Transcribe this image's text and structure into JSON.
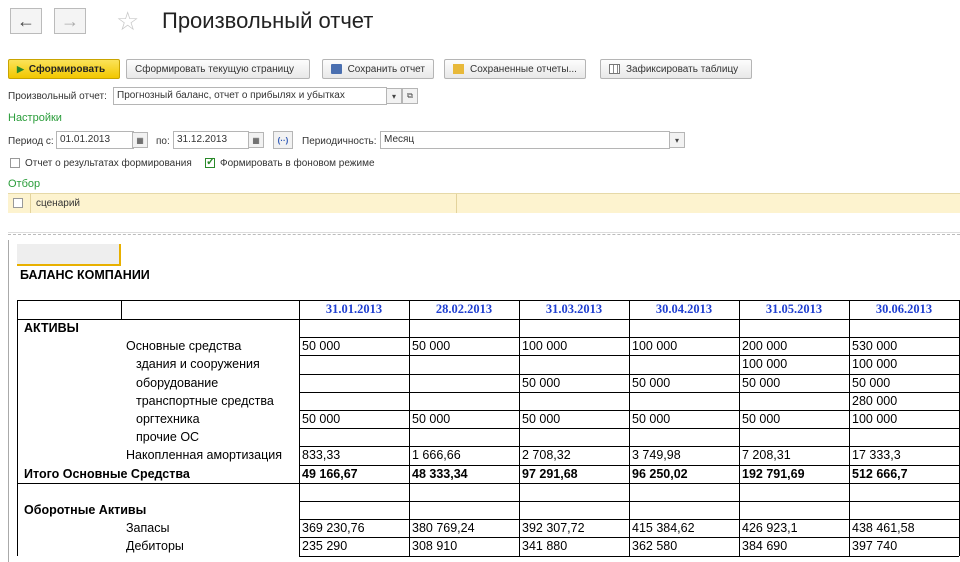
{
  "window": {
    "title": "Произвольный отчет"
  },
  "toolbar": {
    "generate": "Сформировать",
    "generate_page": "Сформировать текущую страницу",
    "save": "Сохранить отчет",
    "saved": "Сохраненные отчеты...",
    "fix_table": "Зафиксировать таблицу"
  },
  "report_select": {
    "label": "Произвольный отчет:",
    "value": "Прогнозный баланс, отчет о прибылях и убытках"
  },
  "settings": {
    "heading": "Настройки",
    "period_from_label": "Период с:",
    "period_from": "01.01.2013",
    "period_to_label": "по:",
    "period_to": "31.12.2013",
    "periodicity_label": "Периодичность:",
    "periodicity": "Месяц",
    "opt_results": "Отчет о результатах формирования",
    "opt_results_checked": false,
    "opt_background": "Формировать в фоновом режиме",
    "opt_background_checked": true
  },
  "filter": {
    "heading": "Отбор",
    "item": "сценарий"
  },
  "report": {
    "title": "БАЛАНС КОМПАНИИ",
    "dates": [
      "31.01.2013",
      "28.02.2013",
      "31.03.2013",
      "30.04.2013",
      "31.05.2013",
      "30.06.2013"
    ],
    "rows": [
      {
        "label": "АКТИВЫ",
        "level": 0,
        "bold": true,
        "values": [
          "",
          "",
          "",
          "",
          "",
          ""
        ]
      },
      {
        "label": "Основные средства",
        "level": 1,
        "bold": false,
        "values": [
          "50 000",
          "50 000",
          "100 000",
          "100 000",
          "200 000",
          "530 000"
        ]
      },
      {
        "label": "здания и сооружения",
        "level": 2,
        "bold": false,
        "values": [
          "",
          "",
          "",
          "",
          "100 000",
          "100 000"
        ]
      },
      {
        "label": "оборудование",
        "level": 2,
        "bold": false,
        "values": [
          "",
          "",
          "50 000",
          "50 000",
          "50 000",
          "50 000"
        ]
      },
      {
        "label": "транспортные средства",
        "level": 2,
        "bold": false,
        "values": [
          "",
          "",
          "",
          "",
          "",
          "280 000"
        ]
      },
      {
        "label": "оргтехника",
        "level": 2,
        "bold": false,
        "values": [
          "50 000",
          "50 000",
          "50 000",
          "50 000",
          "50 000",
          "100 000"
        ]
      },
      {
        "label": "прочие ОС",
        "level": 2,
        "bold": false,
        "values": [
          "",
          "",
          "",
          "",
          "",
          ""
        ]
      },
      {
        "label": "Накопленная амортизация",
        "level": 1,
        "bold": false,
        "values": [
          "833,33",
          "1 666,66",
          "2 708,32",
          "3 749,98",
          "7 208,31",
          "17 333,3"
        ]
      },
      {
        "label": "Итого Основные Средства",
        "level": 0,
        "bold": true,
        "values": [
          "49 166,67",
          "48 333,34",
          "97 291,68",
          "96 250,02",
          "192 791,69",
          "512 666,7"
        ]
      },
      {
        "label": "",
        "level": 0,
        "bold": false,
        "values": [
          "",
          "",
          "",
          "",
          "",
          ""
        ]
      },
      {
        "label": "Оборотные Активы",
        "level": 0,
        "bold": true,
        "values": [
          "",
          "",
          "",
          "",
          "",
          ""
        ]
      },
      {
        "label": "Запасы",
        "level": 1,
        "bold": false,
        "values": [
          "369 230,76",
          "380 769,24",
          "392 307,72",
          "415 384,62",
          "426 923,1",
          "438 461,58"
        ]
      },
      {
        "label": "Дебиторы",
        "level": 1,
        "bold": false,
        "values": [
          "235 290",
          "308 910",
          "341 880",
          "362 580",
          "384 690",
          "397 740"
        ]
      }
    ]
  }
}
